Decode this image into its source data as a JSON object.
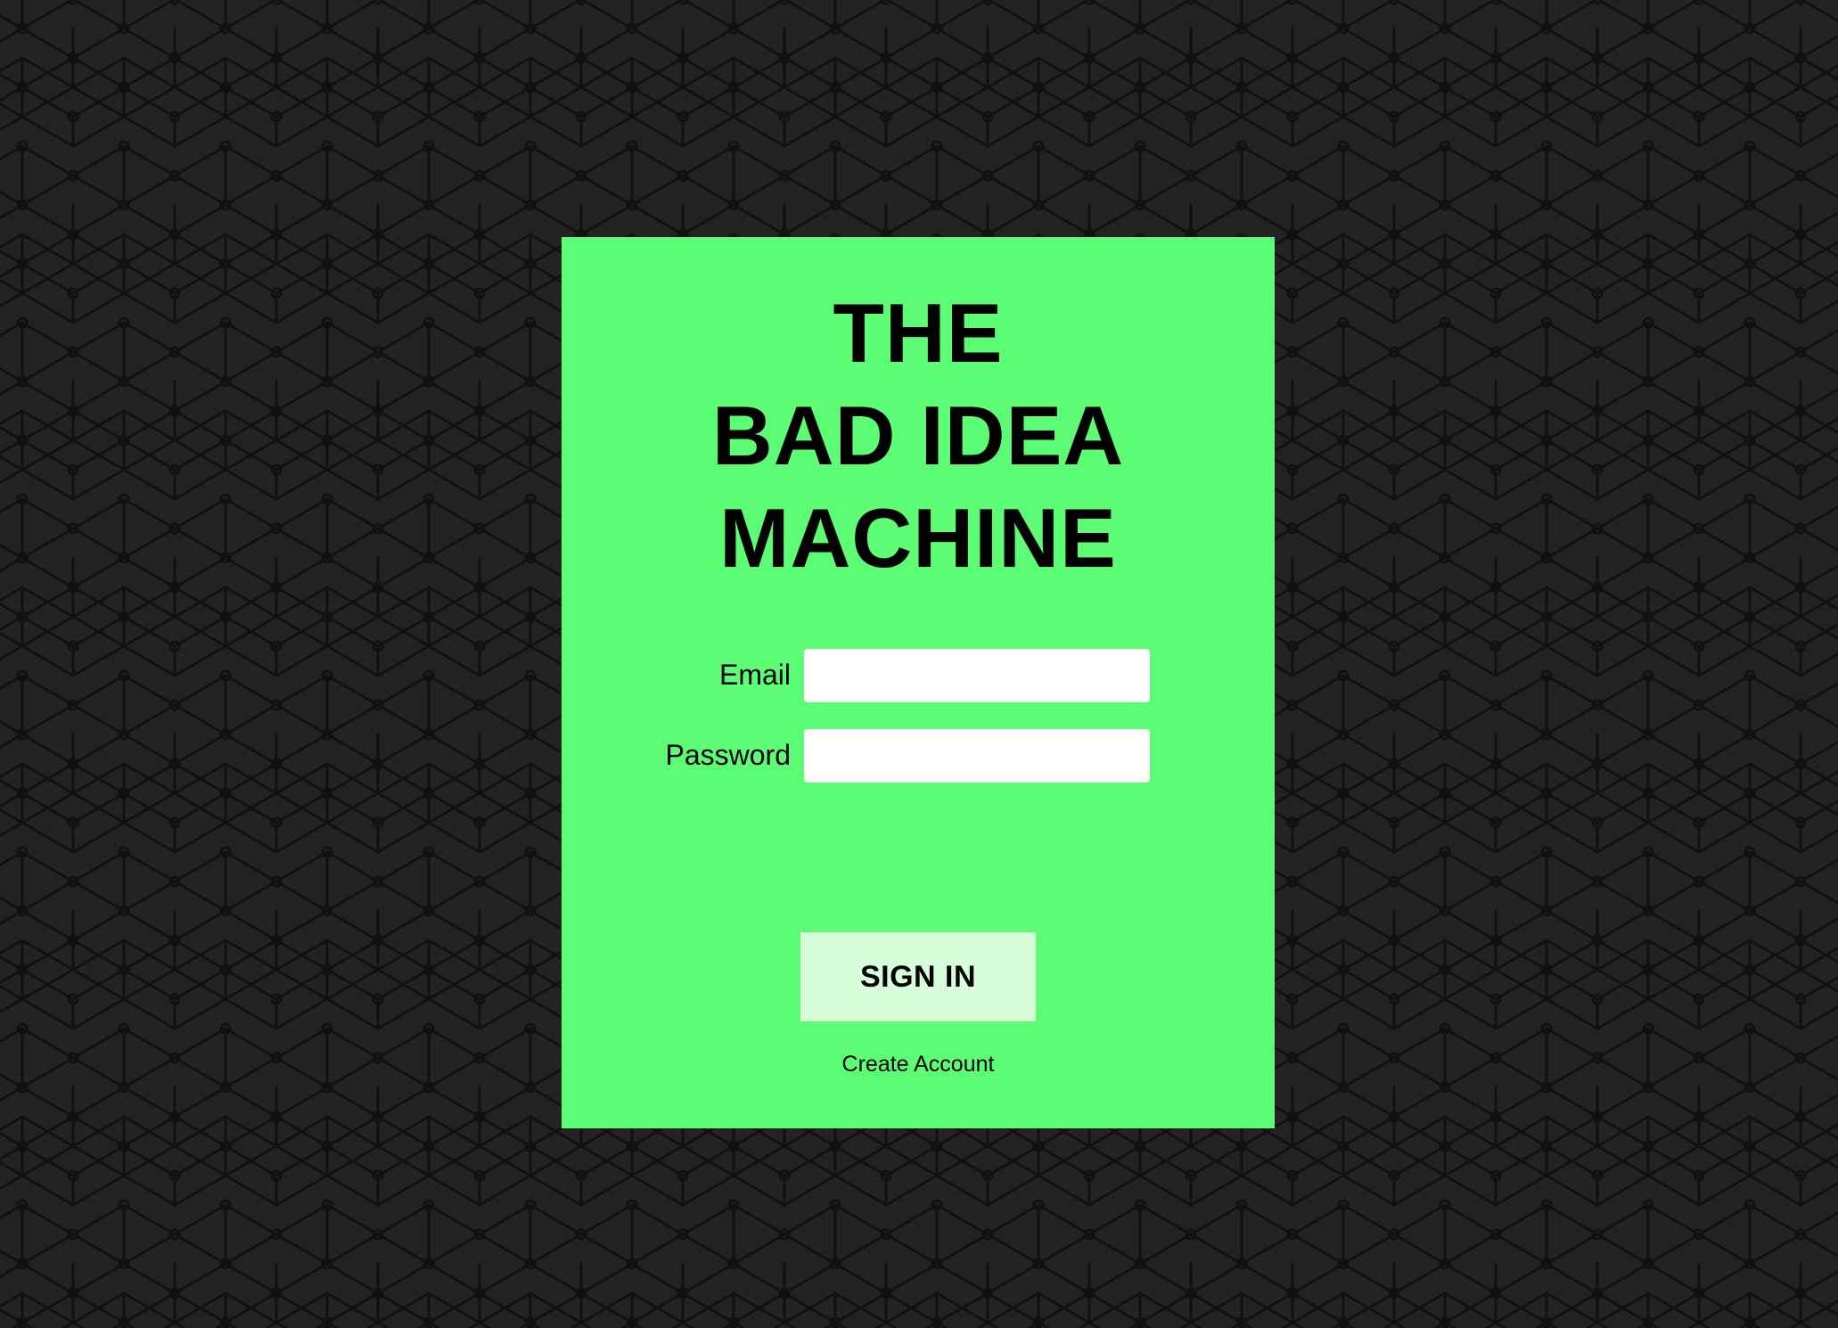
{
  "colors": {
    "background": "#232323",
    "pattern_stroke": "#111111",
    "card": "#5dfc75",
    "button": "#d6fed9",
    "text": "#000000"
  },
  "title": {
    "line1": "THE",
    "line2": "BAD IDEA",
    "line3": "MACHINE"
  },
  "form": {
    "email_label": "Email",
    "email_value": "",
    "password_label": "Password",
    "password_value": ""
  },
  "signin_label": "SIGN IN",
  "create_account_label": "Create Account"
}
